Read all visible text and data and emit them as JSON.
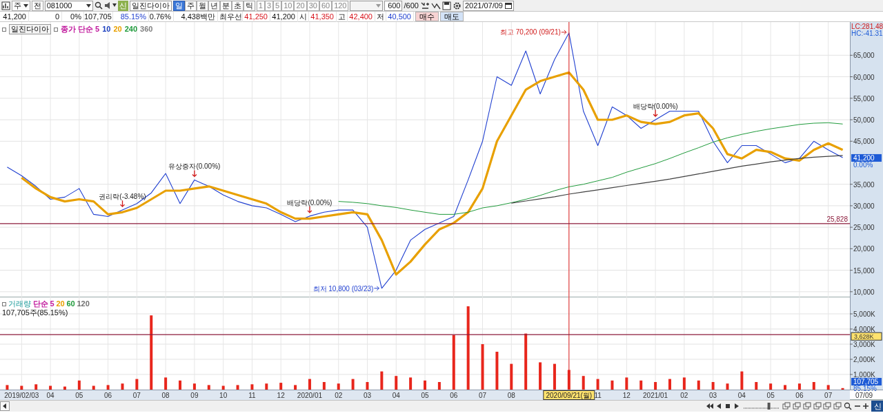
{
  "toolbar": {
    "market": "주",
    "mode": "전",
    "code": "081000",
    "sign_badge": "신",
    "stock_name": "일진다이아",
    "periods": [
      {
        "label": "일",
        "selected": true
      },
      {
        "label": "주",
        "selected": false
      },
      {
        "label": "월",
        "selected": false
      },
      {
        "label": "년",
        "selected": false
      },
      {
        "label": "분",
        "selected": false
      },
      {
        "label": "초",
        "selected": false
      },
      {
        "label": "틱",
        "selected": false
      }
    ],
    "intervals": [
      {
        "label": "1",
        "selected": false
      },
      {
        "label": "3",
        "selected": false
      },
      {
        "label": "5",
        "selected": false
      },
      {
        "label": "10",
        "selected": false
      },
      {
        "label": "20",
        "selected": false
      },
      {
        "label": "30",
        "selected": false
      },
      {
        "label": "60",
        "selected": false
      },
      {
        "label": "120",
        "selected": false
      }
    ],
    "count": "600",
    "count_total": "/600",
    "date": "2021/07/09"
  },
  "quote": {
    "cells": [
      {
        "text": "41,200",
        "kind": "value"
      },
      {
        "text": "0",
        "kind": "value"
      },
      {
        "text": "0%",
        "kind": "value"
      },
      {
        "text": "107,705",
        "kind": "value"
      },
      {
        "text": "85.15%",
        "kind": "value",
        "color": "#1f3fd0"
      },
      {
        "text": "0.76%",
        "kind": "value"
      },
      {
        "text": "4,438백만",
        "kind": "value"
      },
      {
        "text": "최우선",
        "kind": "label"
      },
      {
        "text": "41,250",
        "kind": "value",
        "color": "#d8141c"
      },
      {
        "text": "41,200",
        "kind": "value"
      },
      {
        "text": "시",
        "kind": "label"
      },
      {
        "text": "41,350",
        "kind": "value",
        "color": "#d8141c"
      },
      {
        "text": "고",
        "kind": "label"
      },
      {
        "text": "42,400",
        "kind": "value",
        "color": "#d8141c"
      },
      {
        "text": "저",
        "kind": "label"
      },
      {
        "text": "40,500",
        "kind": "value",
        "color": "#1f3fd0"
      }
    ],
    "buttons": [
      {
        "label": "매수",
        "kind": "buy"
      },
      {
        "label": "매도",
        "kind": "sell"
      }
    ]
  },
  "price_pane": {
    "title": "일진다이아",
    "legend": [
      {
        "text": "종가 단순 5",
        "color": "#c0189c"
      },
      {
        "text": "10",
        "color": "#1a3fbf"
      },
      {
        "text": "20",
        "color": "#e8a000"
      },
      {
        "text": "240",
        "color": "#1e9a3a"
      },
      {
        "text": "360",
        "color": "#808080"
      }
    ],
    "axis_header": [
      "LC:281.48",
      "HC:-41.31"
    ],
    "last_tag": {
      "label": "41,200",
      "sublabel": "0.00%"
    },
    "chart_data": {
      "type": "line",
      "grid": true,
      "ylim": [
        8690,
        72730
      ],
      "yticks": [
        {
          "value": 10000,
          "label": "10,000"
        },
        {
          "value": 15000,
          "label": "15,000"
        },
        {
          "value": 20000,
          "label": "20,000"
        },
        {
          "value": 25000,
          "label": "25,000"
        },
        {
          "value": 30000,
          "label": "30,000"
        },
        {
          "value": 35000,
          "label": "35,000"
        },
        {
          "value": 45000,
          "label": "45,000"
        },
        {
          "value": 50000,
          "label": "50,000"
        },
        {
          "value": 55000,
          "label": "55,000"
        },
        {
          "value": 60000,
          "label": "60,000"
        },
        {
          "value": 65000,
          "label": "65,000"
        }
      ],
      "categories": [
        null,
        null,
        null,
        null,
        null,
        null,
        null,
        null,
        null,
        null,
        null,
        null,
        null,
        null,
        null,
        null,
        null,
        null,
        null,
        null,
        null,
        null,
        null,
        null,
        null,
        null,
        null,
        null,
        null,
        null,
        null,
        null,
        null,
        null,
        null,
        null,
        null,
        null,
        null,
        null,
        null,
        null,
        null,
        null,
        null,
        null,
        null,
        null,
        null,
        null,
        null,
        null,
        null,
        null,
        null,
        null,
        null,
        null,
        null
      ],
      "series": [
        {
          "color": "#1f3fd0",
          "values": [
            39000,
            37000,
            34500,
            31500,
            32000,
            34000,
            28000,
            27500,
            29000,
            30500,
            33000,
            37500,
            30500,
            36000,
            34500,
            32500,
            31000,
            30000,
            29500,
            28000,
            26300,
            27600,
            28500,
            29000,
            29000,
            25000,
            10800,
            15000,
            22000,
            24500,
            26000,
            27500,
            36000,
            45000,
            60000,
            58000,
            66000,
            56000,
            64000,
            70200,
            52000,
            44000,
            53000,
            51000,
            48000,
            50000,
            52000,
            52000,
            52000,
            45000,
            40000,
            44000,
            44000,
            42000,
            40000,
            41000,
            45000,
            43000,
            41200
          ]
        },
        {
          "color": "#e8a000",
          "values": [
            null,
            36500,
            34000,
            32000,
            31000,
            31500,
            31000,
            28000,
            28500,
            29500,
            31500,
            33500,
            33500,
            34000,
            34500,
            33500,
            32500,
            31500,
            30500,
            28500,
            27000,
            27000,
            27500,
            28000,
            28500,
            28000,
            22000,
            14000,
            17000,
            21000,
            24500,
            26000,
            28500,
            34000,
            45000,
            51000,
            57000,
            59000,
            60000,
            61000,
            57000,
            50000,
            50000,
            51000,
            49500,
            49000,
            49500,
            51000,
            51500,
            48000,
            42000,
            41000,
            43000,
            42500,
            41000,
            40500,
            43000,
            44500,
            43000
          ]
        },
        {
          "color": "#1e9a3a",
          "values": [
            null,
            null,
            null,
            null,
            null,
            null,
            null,
            null,
            null,
            null,
            null,
            null,
            null,
            null,
            null,
            null,
            null,
            null,
            null,
            null,
            null,
            null,
            null,
            31000,
            30800,
            30500,
            30000,
            29600,
            29000,
            28500,
            28000,
            28000,
            28500,
            29500,
            30000,
            30700,
            31500,
            32400,
            33500,
            34400,
            35000,
            35800,
            36600,
            37800,
            38800,
            39800,
            41000,
            42300,
            43500,
            44800,
            45800,
            46600,
            47300,
            47900,
            48400,
            48900,
            49200,
            49300,
            49000
          ]
        },
        {
          "color": "#404040",
          "values": [
            null,
            null,
            null,
            null,
            null,
            null,
            null,
            null,
            null,
            null,
            null,
            null,
            null,
            null,
            null,
            null,
            null,
            null,
            null,
            null,
            null,
            null,
            null,
            null,
            null,
            null,
            null,
            null,
            null,
            null,
            null,
            null,
            null,
            null,
            null,
            30600,
            31100,
            31600,
            32100,
            32700,
            33200,
            33700,
            34200,
            34700,
            35200,
            35700,
            36200,
            36800,
            37400,
            38000,
            38600,
            39200,
            39700,
            40200,
            40600,
            41000,
            41300,
            41500,
            41700
          ]
        }
      ],
      "ref_lines": [
        {
          "axis": "y",
          "value": 25828,
          "label": "25,828"
        }
      ],
      "annotations": [
        "최고 70,200 (09/21)",
        "최저 10,800 (03/23)",
        {
          "y": 29000,
          "text": "권리락(-3.48%)"
        },
        {
          "y": 36000,
          "text": "유상증자(0.00%)"
        },
        {
          "y": 27600,
          "text": "배당락(0.00%)"
        },
        {
          "y": 50000,
          "text": "배당락(0.00%)"
        }
      ]
    }
  },
  "volume_pane": {
    "title": "거래량",
    "legend": [
      {
        "text": "단순 5",
        "color": "#c0189c"
      },
      {
        "text": "20",
        "color": "#e8a000"
      },
      {
        "text": "60",
        "color": "#1e9a3a"
      },
      {
        "text": "120",
        "color": "#707070"
      }
    ],
    "reading": "107,705주(85.15%)",
    "last_tag": {
      "label": "107,705",
      "sublabel": "85.15%"
    },
    "chart_data": {
      "type": "bar",
      "grid": true,
      "ylim": [
        0,
        6090
      ],
      "yticks": [
        {
          "value": 1000,
          "label": "1,000K"
        },
        {
          "value": 2000,
          "label": "2,000K"
        },
        {
          "value": 3000,
          "label": "3,000K"
        },
        {
          "value": 4000,
          "label": "4,000K"
        },
        {
          "value": 5000,
          "label": "5,000K"
        }
      ],
      "categories": [
        null,
        "2019/02/03",
        null,
        "04",
        null,
        "05",
        null,
        "06",
        null,
        "07",
        null,
        "08",
        null,
        "09",
        null,
        "10",
        null,
        "11",
        null,
        "12",
        null,
        "2020/01",
        null,
        "02",
        null,
        "03",
        null,
        "04",
        null,
        "05",
        null,
        "06",
        null,
        "07",
        null,
        "08",
        null,
        null,
        null,
        "2020/09/21(월)",
        null,
        "11",
        null,
        "12",
        null,
        "2021/01",
        null,
        "02",
        null,
        "03",
        null,
        "04",
        null,
        "05",
        null,
        "06",
        null,
        "07",
        null
      ],
      "series": [
        {
          "color": "#e8261c",
          "values": [
            300,
            250,
            350,
            250,
            200,
            600,
            250,
            300,
            400,
            700,
            4900,
            800,
            600,
            400,
            300,
            250,
            300,
            350,
            400,
            450,
            300,
            700,
            500,
            400,
            700,
            500,
            1200,
            900,
            800,
            600,
            500,
            3600,
            5500,
            3000,
            2500,
            1700,
            3700,
            1800,
            1700,
            1300,
            900,
            700,
            600,
            800,
            600,
            500,
            700,
            800,
            600,
            500,
            400,
            1200,
            500,
            400,
            300,
            400,
            500,
            300,
            100
          ]
        }
      ],
      "ref_lines": [
        {
          "axis": "x",
          "value": "2020/09/21(월)"
        },
        {
          "axis": "y",
          "value": 3628,
          "label": "3,628K"
        }
      ]
    }
  },
  "x_axis_end": "07/09",
  "bottom_bar": {
    "zoom_slider": {
      "level": 0.72
    },
    "signal_label": "신"
  }
}
